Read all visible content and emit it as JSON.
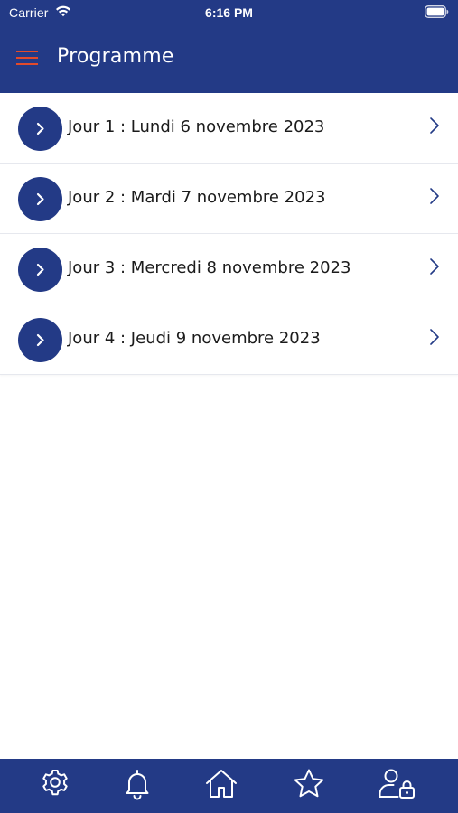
{
  "colors": {
    "brand": "#233a86",
    "accent": "#e24a2a",
    "text": "#1b1b1b",
    "white": "#ffffff"
  },
  "status_bar": {
    "carrier": "Carrier",
    "time": "6:16 PM",
    "icons": [
      "wifi-icon",
      "battery-icon"
    ]
  },
  "header": {
    "title": "Programme",
    "menu_icon": "hamburger-menu-icon"
  },
  "program_days": [
    {
      "label": "Jour 1 : Lundi 6 novembre 2023"
    },
    {
      "label": "Jour 2 : Mardi 7 novembre 2023"
    },
    {
      "label": "Jour 3 : Mercredi 8 novembre 2023"
    },
    {
      "label": "Jour 4 : Jeudi 9 novembre 2023"
    }
  ],
  "tab_bar": {
    "tabs": [
      {
        "icon": "settings-gear-icon"
      },
      {
        "icon": "notifications-bell-icon"
      },
      {
        "icon": "home-icon"
      },
      {
        "icon": "favorites-star-icon"
      },
      {
        "icon": "account-lock-icon"
      }
    ]
  }
}
